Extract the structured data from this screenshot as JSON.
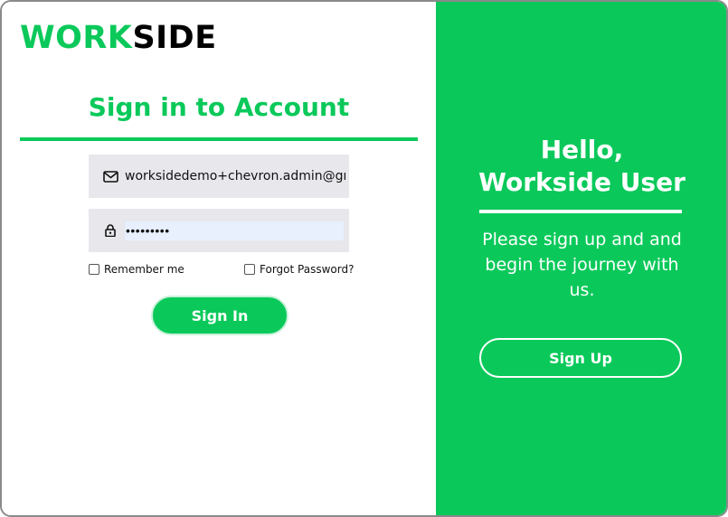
{
  "brand": {
    "part1": "WORK",
    "part2": "SIDE",
    "accent_color": "#0ac95a"
  },
  "signin": {
    "title": "Sign in to Account",
    "email_value": "worksidedemo+chevron.admin@gmail.com",
    "password_value": "•••••••••",
    "remember_label": "Remember me",
    "forgot_label": "Forgot Password?",
    "button_label": "Sign In"
  },
  "welcome": {
    "heading_line1": "Hello,",
    "heading_line2": "Workside User",
    "message": "Please sign up and and begin the journey with us.",
    "signup_label": "Sign Up"
  },
  "icons": {
    "email": "envelope-icon",
    "password": "lock-icon"
  }
}
